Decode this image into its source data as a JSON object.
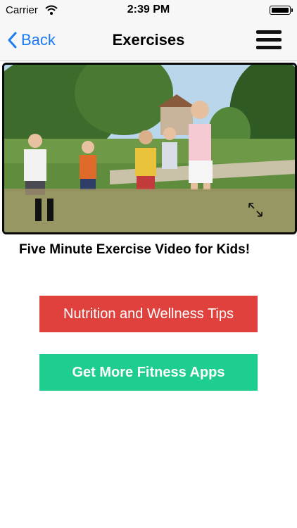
{
  "status_bar": {
    "carrier": "Carrier",
    "time": "2:39 PM",
    "icons": [
      "wifi-icon",
      "battery-icon"
    ]
  },
  "nav": {
    "back_label": "Back",
    "title": "Exercises",
    "menu_icon": "hamburger-menu-icon"
  },
  "video": {
    "controls": [
      "pause-icon",
      "fullscreen-icon"
    ]
  },
  "video_title": "Five Minute Exercise Video for Kids!",
  "buttons": {
    "nutrition": "Nutrition and Wellness Tips",
    "fitness": "Get More Fitness Apps"
  },
  "colors": {
    "back_blue": "#1a7cf5",
    "nutrition_red": "#e0413d",
    "fitness_green": "#1dce8f"
  }
}
